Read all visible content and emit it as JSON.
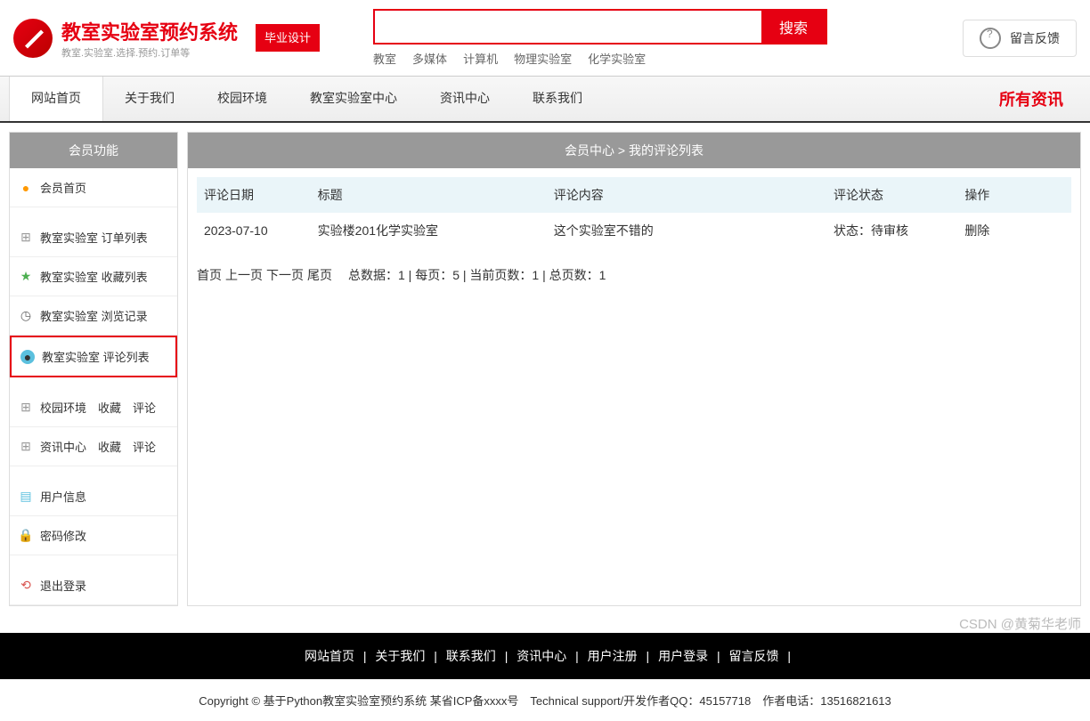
{
  "header": {
    "title": "教室实验室预约系统",
    "subtitle": "教室.实验室.选择.预约.订单等",
    "badge": "毕业设计",
    "search_placeholder": "",
    "search_button": "搜索",
    "search_tags": [
      "教室",
      "多媒体",
      "计算机",
      "物理实验室",
      "化学实验室"
    ],
    "feedback": "留言反馈"
  },
  "nav": {
    "items": [
      "网站首页",
      "关于我们",
      "校园环境",
      "教室实验室中心",
      "资讯中心",
      "联系我们"
    ],
    "right": "所有资讯"
  },
  "sidebar": {
    "title": "会员功能",
    "items": [
      {
        "label": "会员首页",
        "icon": "home"
      },
      {
        "label": "教室实验室 订单列表",
        "icon": "grid"
      },
      {
        "label": "教室实验室 收藏列表",
        "icon": "star"
      },
      {
        "label": "教室实验室 浏览记录",
        "icon": "clock"
      },
      {
        "label": "教室实验室 评论列表",
        "icon": "comment",
        "active": true
      },
      {
        "label": "校园环境　收藏　评论",
        "icon": "grid"
      },
      {
        "label": "资讯中心　收藏　评论",
        "icon": "grid"
      },
      {
        "label": "用户信息",
        "icon": "doc"
      },
      {
        "label": "密码修改",
        "icon": "lock"
      },
      {
        "label": "退出登录",
        "icon": "exit"
      }
    ]
  },
  "main": {
    "breadcrumb": "会员中心 > 我的评论列表",
    "columns": [
      "评论日期",
      "标题",
      "评论内容",
      "评论状态",
      "操作"
    ],
    "rows": [
      {
        "date": "2023-07-10",
        "title": "实验楼201化学实验室",
        "content": "这个实验室不错的",
        "status": "状态：待审核",
        "action": "删除"
      }
    ],
    "pagination": {
      "links": [
        "首页",
        "上一页",
        "下一页",
        "尾页"
      ],
      "info": "总数据：1 | 每页：5 | 当前页数：1 | 总页数：1"
    }
  },
  "footer": {
    "links": [
      "网站首页",
      "关于我们",
      "联系我们",
      "资讯中心",
      "用户注册",
      "用户登录",
      "留言反馈"
    ],
    "copyright": "Copyright © 基于Python教室实验室预约系统 某省ICP备xxxx号　Technical support/开发作者QQ：45157718　作者电话：13516821613"
  },
  "watermark": "CSDN @黄菊华老师"
}
